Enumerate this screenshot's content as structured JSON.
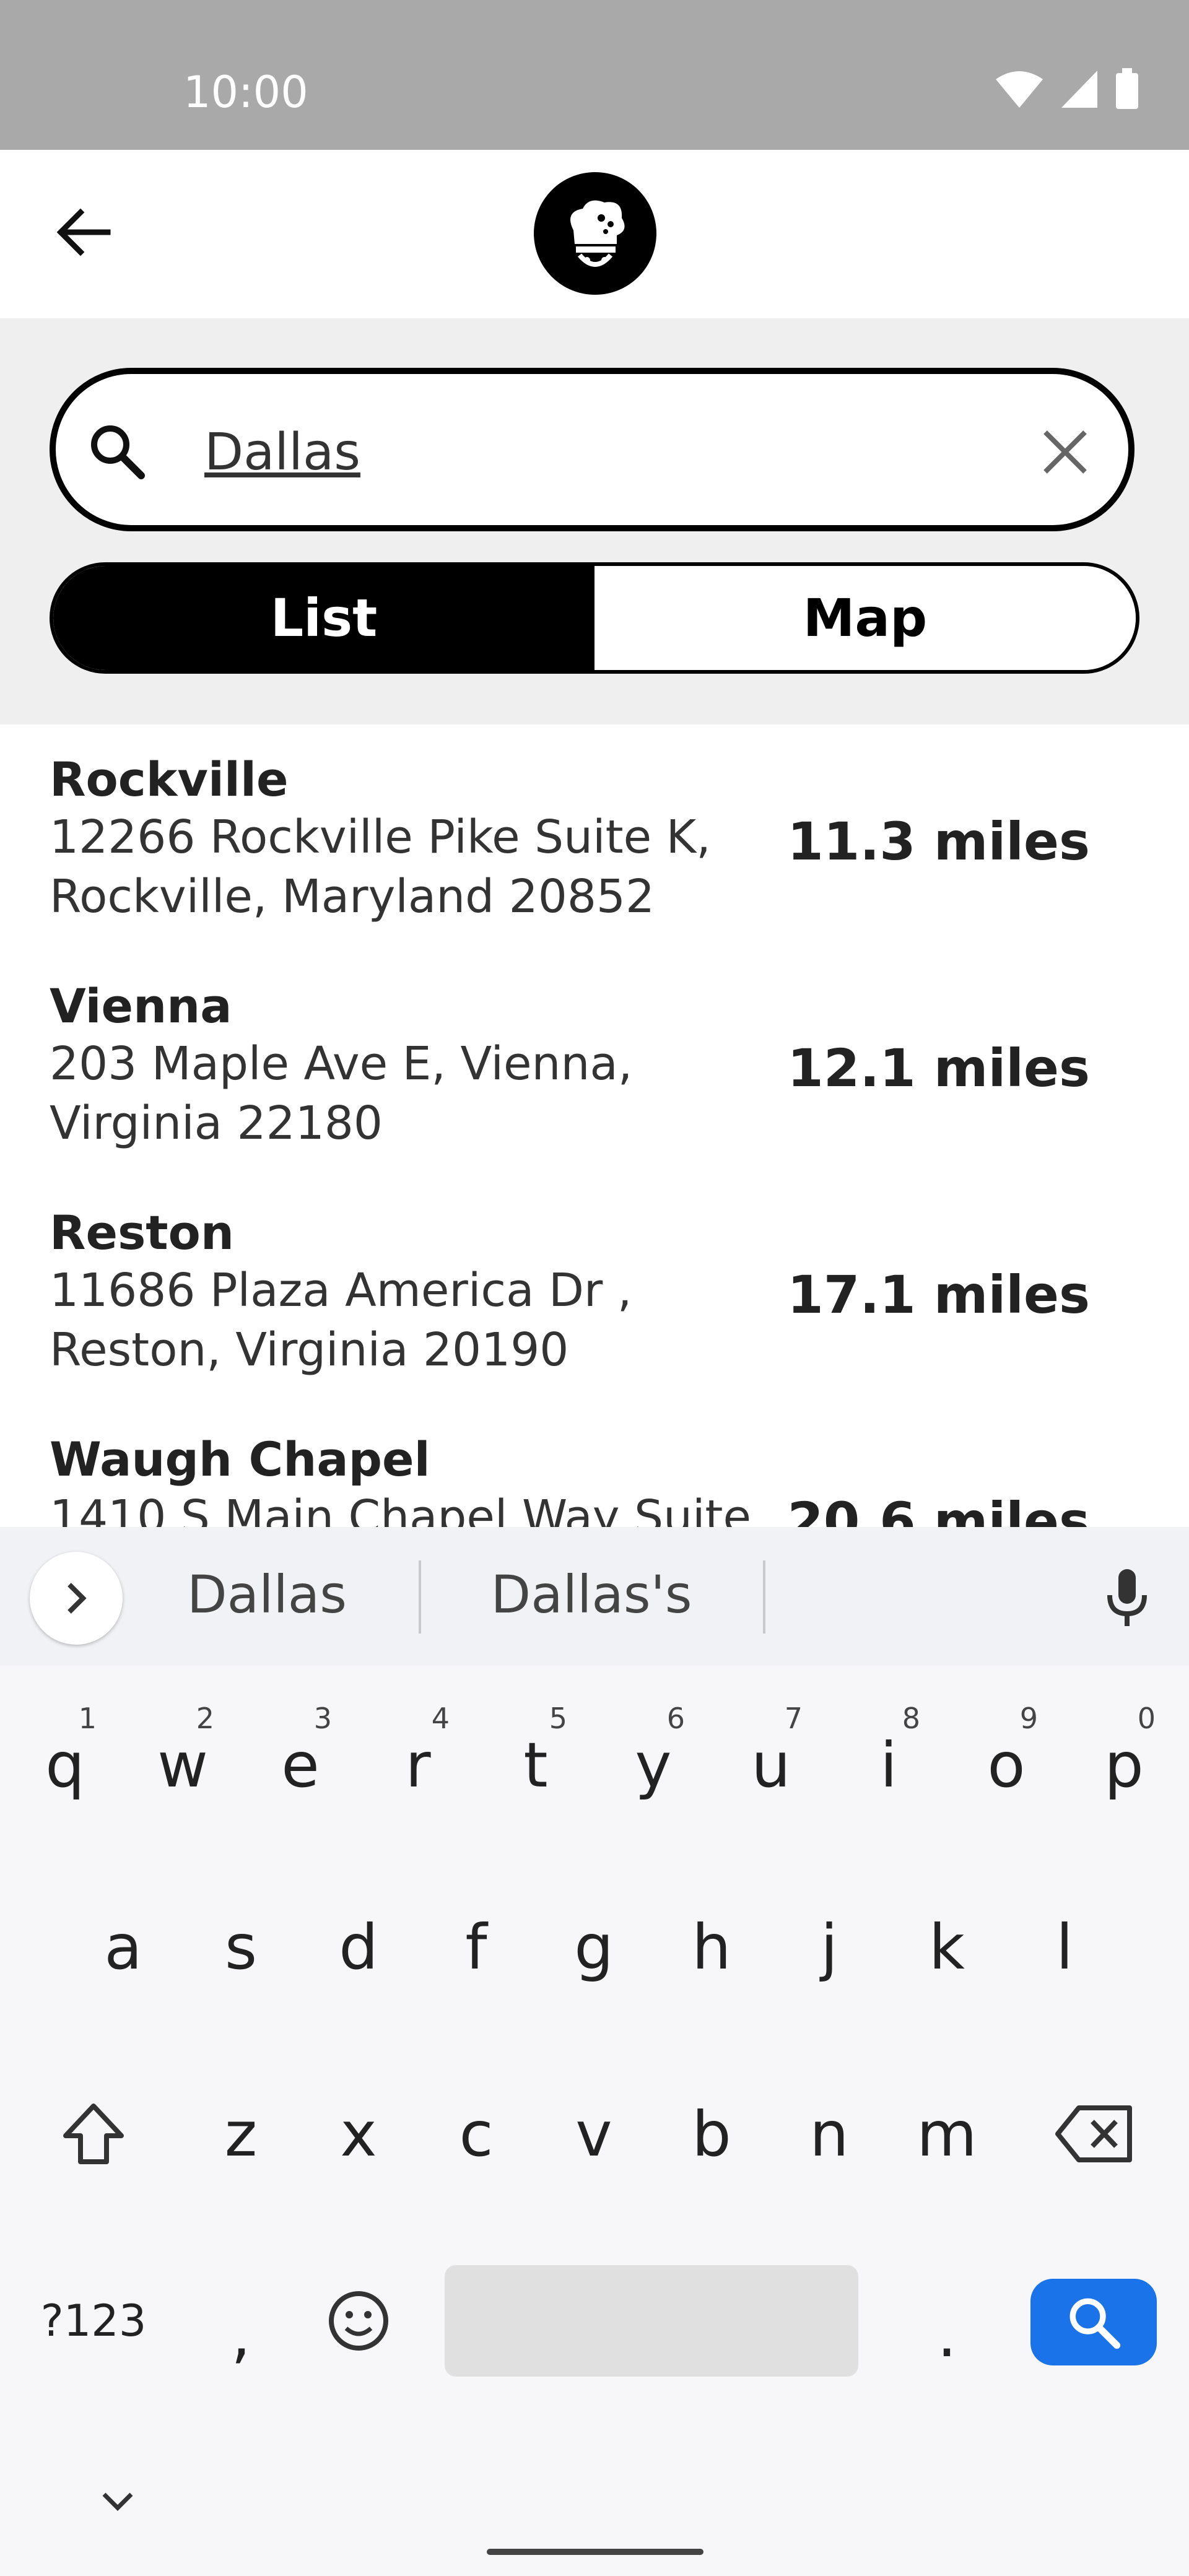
{
  "status_bar": {
    "time": "10:00"
  },
  "search": {
    "query": "Dallas"
  },
  "view_toggle": {
    "list_label": "List",
    "map_label": "Map",
    "selected": "List"
  },
  "results": [
    {
      "name": "Rockville",
      "address_line1": "12266 Rockville Pike Suite K,",
      "address_line2": "Rockville, Maryland 20852",
      "distance": "11.3 miles"
    },
    {
      "name": "Vienna",
      "address_line1": "203 Maple Ave E, Vienna,",
      "address_line2": "Virginia 22180",
      "distance": "12.1 miles"
    },
    {
      "name": "Reston",
      "address_line1": "11686 Plaza America Dr ,",
      "address_line2": "Reston, Virginia 20190",
      "distance": "17.1 miles"
    },
    {
      "name": "Waugh Chapel",
      "address_line1": "1410 S Main Chapel Way Suite",
      "address_line2": "",
      "distance": "20.6 miles"
    }
  ],
  "keyboard": {
    "suggestions": [
      "Dallas",
      "Dallas's"
    ],
    "row1": [
      "q",
      "w",
      "e",
      "r",
      "t",
      "y",
      "u",
      "i",
      "o",
      "p"
    ],
    "row1_numbers": [
      "1",
      "2",
      "3",
      "4",
      "5",
      "6",
      "7",
      "8",
      "9",
      "0"
    ],
    "row2": [
      "a",
      "s",
      "d",
      "f",
      "g",
      "h",
      "j",
      "k",
      "l"
    ],
    "row3": [
      "z",
      "x",
      "c",
      "v",
      "b",
      "n",
      "m"
    ],
    "symbols_label": "?123",
    "comma": ",",
    "period": "."
  },
  "colors": {
    "accent": "#000000",
    "search_key": "#1a73e8",
    "status_bar": "#a9a9a9"
  },
  "icons": [
    "wifi-icon",
    "signal-icon",
    "battery-icon",
    "back-arrow-icon",
    "chef-logo-icon",
    "search-icon",
    "clear-icon",
    "chevron-right-icon",
    "mic-icon",
    "shift-icon",
    "backspace-icon",
    "emoji-icon",
    "keyboard-search-icon",
    "chevron-down-icon"
  ]
}
